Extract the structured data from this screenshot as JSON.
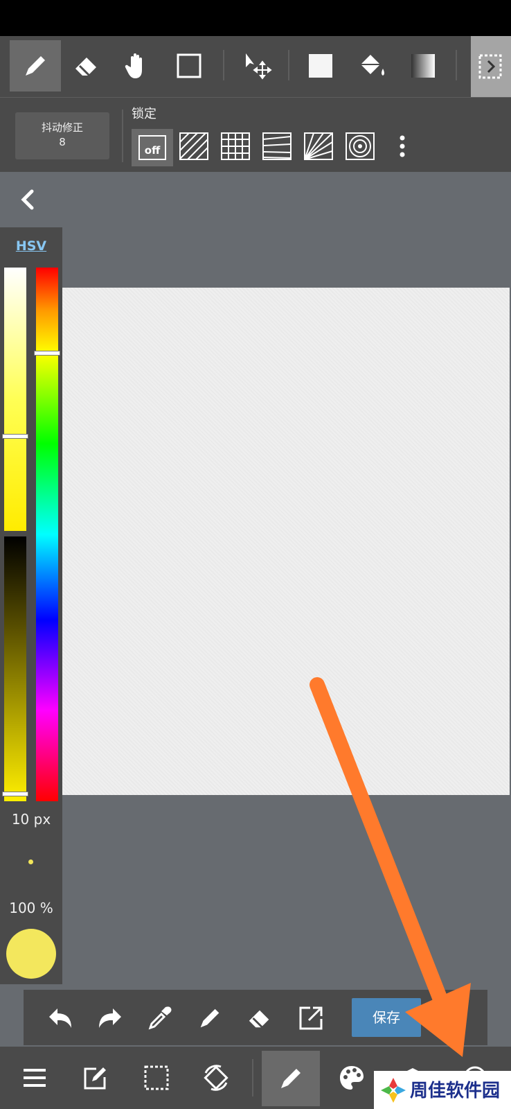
{
  "toolbar": {
    "tools": [
      "pen-tool",
      "eraser-tool",
      "hand-tool",
      "shape-tool",
      "move-tool",
      "fill-color-tool",
      "bucket-tool",
      "gradient-tool",
      "selection-tool"
    ],
    "active_tool": "pen-tool"
  },
  "subbar": {
    "stabilizer_label": "抖动修正",
    "stabilizer_value": "8",
    "lock_label": "锁定",
    "lock_off_label": "off"
  },
  "palette": {
    "mode_label": "HSV",
    "brush_size": "10 px",
    "opacity": "100 %",
    "current_color": "#f3e75d",
    "saturation_level": 0.64,
    "value_level": 0.97,
    "hue_level": 0.16
  },
  "actionbar": {
    "save_label": "保存"
  },
  "bottombar": {
    "items": [
      "menu-icon",
      "edit-icon",
      "selection-icon",
      "rotate-icon",
      "pen-icon",
      "palette-icon",
      "layers-icon",
      "more-icon"
    ],
    "active_item": "pen-icon"
  },
  "watermark": {
    "text": "周佳软件园"
  },
  "colors": {
    "arrow": "#ff7a2c",
    "bar_bg": "#4a4a4a",
    "canvas_bg": "#676b70",
    "accent": "#4a86b8"
  }
}
